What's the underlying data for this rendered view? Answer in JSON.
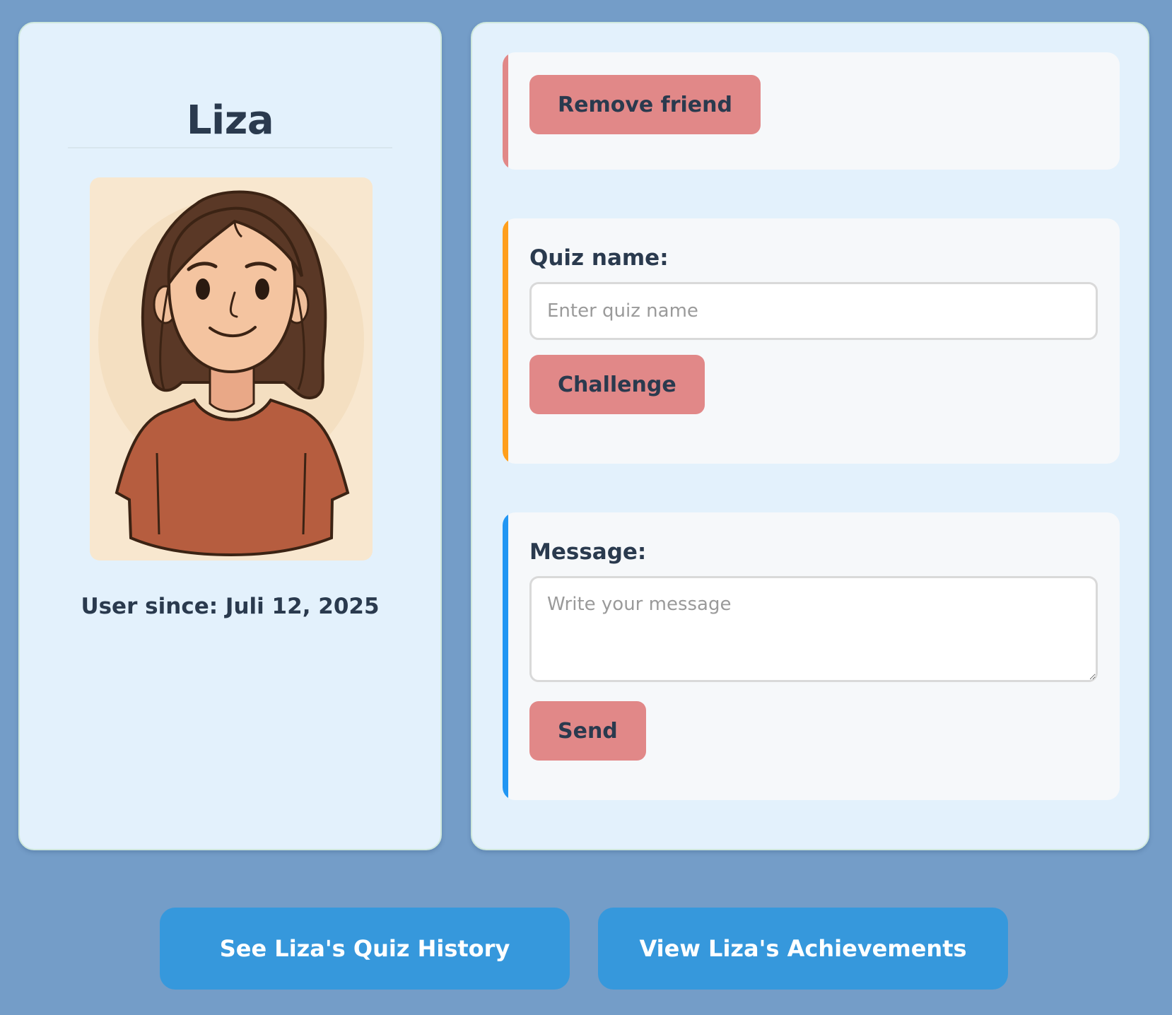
{
  "profile": {
    "name": "Liza",
    "user_since": "User since: Juli 12, 2025",
    "avatar_icon": "woman-avatar-illustration"
  },
  "remove_section": {
    "button_label": "Remove friend",
    "accent_color": "#e18888"
  },
  "challenge_section": {
    "label": "Quiz name:",
    "input_placeholder": "Enter quiz name",
    "input_value": "",
    "button_label": "Challenge",
    "accent_color": "#ff9f1c"
  },
  "message_section": {
    "label": "Message:",
    "input_placeholder": "Write your message",
    "input_value": "",
    "button_label": "Send",
    "accent_color": "#2196f3"
  },
  "footer": {
    "history_label": "See Liza's Quiz History",
    "achievements_label": "View Liza's Achievements"
  },
  "colors": {
    "page_background": "#749dc8",
    "card_background": "#e3f1fc",
    "action_button": "#e18888",
    "primary_button": "#3698dc",
    "text": "#2a3a4e"
  }
}
